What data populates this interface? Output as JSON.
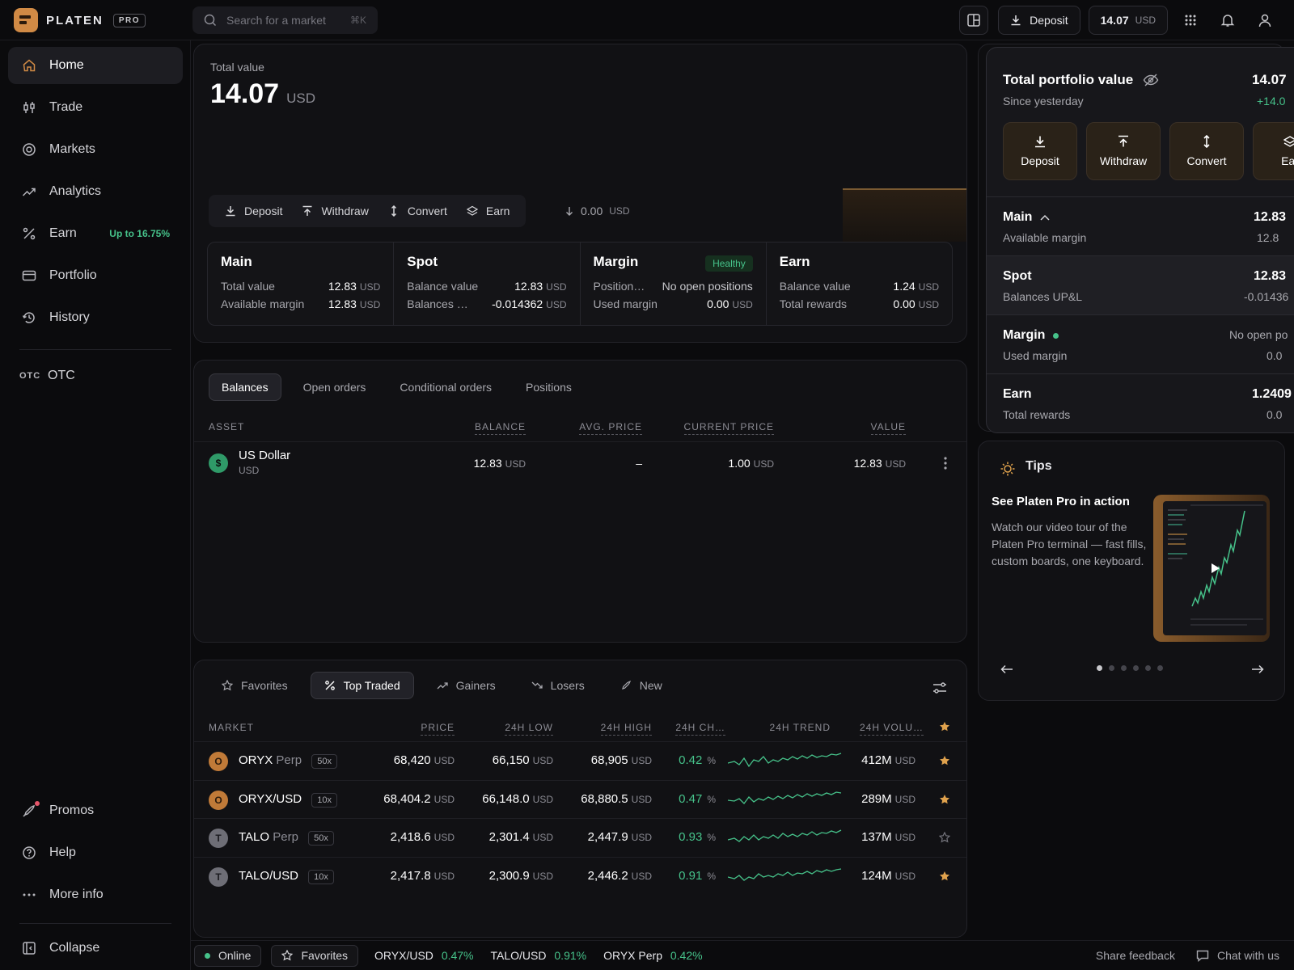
{
  "brand": {
    "name": "PLATEN",
    "tag": "PRO"
  },
  "search": {
    "placeholder": "Search for a market",
    "shortcut": "⌘K"
  },
  "topbar": {
    "deposit_label": "Deposit",
    "balance_value": "14.07",
    "balance_unit": "USD"
  },
  "sidebar": {
    "items": [
      {
        "label": "Home",
        "icon": "home-icon"
      },
      {
        "label": "Trade",
        "icon": "trade-icon"
      },
      {
        "label": "Markets",
        "icon": "markets-icon"
      },
      {
        "label": "Analytics",
        "icon": "analytics-icon"
      },
      {
        "label": "Earn",
        "icon": "percent-icon",
        "badge": "Up to 16.75%"
      },
      {
        "label": "Portfolio",
        "icon": "portfolio-icon"
      },
      {
        "label": "History",
        "icon": "history-icon"
      }
    ],
    "otc": {
      "prefix": "OTC",
      "label": "OTC"
    },
    "bottom": [
      {
        "label": "Promos",
        "icon": "rocket-icon"
      },
      {
        "label": "Help",
        "icon": "help-icon"
      },
      {
        "label": "More info",
        "icon": "more-icon"
      },
      {
        "label": "Collapse",
        "icon": "collapse-icon"
      }
    ]
  },
  "total": {
    "label": "Total value",
    "value": "14.07",
    "unit": "USD",
    "actions": [
      "Deposit",
      "Withdraw",
      "Convert",
      "Earn"
    ],
    "pending_value": "0.00",
    "pending_unit": "USD"
  },
  "accounts": {
    "main": {
      "title": "Main",
      "rows": [
        [
          "Total value",
          "12.83"
        ],
        [
          "Available margin",
          "12.83"
        ]
      ]
    },
    "spot": {
      "title": "Spot",
      "rows": [
        [
          "Balance value",
          "12.83"
        ],
        [
          "Balances …",
          "-0.014362"
        ]
      ]
    },
    "margin": {
      "title": "Margin",
      "badge": "Healthy",
      "rows": [
        [
          "Position…",
          "No open positions"
        ],
        [
          "Used margin",
          "0.00"
        ]
      ]
    },
    "earn": {
      "title": "Earn",
      "rows": [
        [
          "Balance value",
          "1.24"
        ],
        [
          "Total rewards",
          "0.00"
        ]
      ]
    },
    "unit": "USD"
  },
  "balances": {
    "tabs": [
      "Balances",
      "Open orders",
      "Conditional orders",
      "Positions"
    ],
    "headers": {
      "asset": "ASSET",
      "balance": "BALANCE",
      "avg": "AVG. PRICE",
      "current": "CURRENT PRICE",
      "value": "VALUE"
    },
    "rows": [
      {
        "name": "US Dollar",
        "code": "USD",
        "balance": "12.83",
        "avg": "–",
        "current": "1.00",
        "value": "12.83",
        "unit": "USD"
      }
    ]
  },
  "markets": {
    "tabs": [
      "Favorites",
      "Top Traded",
      "Gainers",
      "Losers",
      "New"
    ],
    "headers": {
      "market": "MARKET",
      "price": "PRICE",
      "low": "24H LOW",
      "high": "24H HIGH",
      "change": "24H CH…",
      "trend": "24H TREND",
      "volume": "24H VOLU…"
    },
    "unit": "USD",
    "rows": [
      {
        "symbol": "ORYX",
        "suffix": "Perp",
        "lev": "50x",
        "price": "68,420",
        "low": "66,150",
        "high": "68,905",
        "change": "0.42",
        "volume": "412M",
        "fav": true,
        "letter": "O"
      },
      {
        "symbol": "ORYX/USD",
        "suffix": "",
        "lev": "10x",
        "price": "68,404.2",
        "low": "66,148.0",
        "high": "68,880.5",
        "change": "0.47",
        "volume": "289M",
        "fav": true,
        "letter": "O"
      },
      {
        "symbol": "TALO",
        "suffix": "Perp",
        "lev": "50x",
        "price": "2,418.6",
        "low": "2,301.4",
        "high": "2,447.9",
        "change": "0.93",
        "volume": "137M",
        "fav": false,
        "letter": "T"
      },
      {
        "symbol": "TALO/USD",
        "suffix": "",
        "lev": "10x",
        "price": "2,417.8",
        "low": "2,300.9",
        "high": "2,446.2",
        "change": "0.91",
        "volume": "124M",
        "fav": true,
        "letter": "T"
      }
    ],
    "pct": "%"
  },
  "portfolio_popover": {
    "title": "Total portfolio value",
    "subtitle": "Since yesterday",
    "value": "14.07",
    "change": "+14.0",
    "actions": [
      "Deposit",
      "Withdraw",
      "Convert",
      "Ear"
    ],
    "sections": [
      {
        "title": "Main",
        "sub": "Available margin",
        "value": "12.83",
        "subvalue": "12.8"
      },
      {
        "title": "Spot",
        "sub": "Balances UP&L",
        "value": "12.83",
        "subvalue": "-0.01436"
      },
      {
        "title": "Margin",
        "sub": "Used margin",
        "value": "No open po",
        "subvalue": "0.0"
      },
      {
        "title": "Earn",
        "sub": "Total rewards",
        "value": "1.2409",
        "subvalue": "0.0"
      }
    ]
  },
  "tips": {
    "title": "Tips",
    "heading": "See Platen Pro in action",
    "body": "Watch our video tour of the Platen Pro terminal — fast fills, custom boards, one keyboard.",
    "active_slide": 1,
    "slide_count": 6
  },
  "statusbar": {
    "online": "Online",
    "favorites": "Favorites",
    "tickers": [
      {
        "name": "ORYX/USD",
        "change": "0.47%"
      },
      {
        "name": "TALO/USD",
        "change": "0.91%"
      },
      {
        "name": "ORYX Perp",
        "change": "0.42%"
      }
    ],
    "feedback": "Share feedback",
    "chat": "Chat with us"
  },
  "colors": {
    "accent": "#d08a45",
    "positive": "#46c28a",
    "negative": "#e5566a",
    "background": "#0b0b0d"
  }
}
